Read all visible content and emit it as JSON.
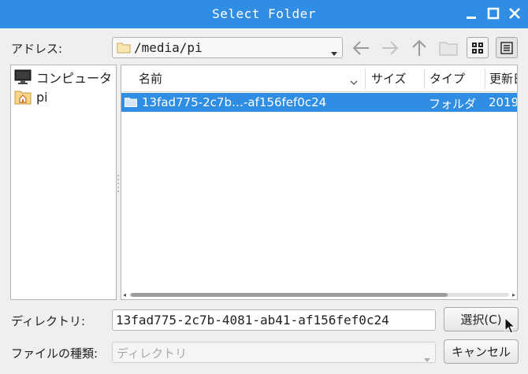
{
  "window": {
    "title": "Select Folder"
  },
  "address": {
    "label": "アドレス:",
    "path": "/media/pi"
  },
  "sidebar": {
    "items": [
      {
        "label": "コンピュータ",
        "icon": "computer-icon"
      },
      {
        "label": "pi",
        "icon": "home-folder-icon"
      }
    ]
  },
  "filelist": {
    "columns": [
      "名前",
      "サイズ",
      "タイプ",
      "更新日"
    ],
    "rows": [
      {
        "name": "13fad775-2c7b…-af156fef0c24",
        "type": "フォルダ",
        "modified": "2019"
      }
    ]
  },
  "directory": {
    "label": "ディレクトリ:",
    "value": "13fad775-2c7b-4081-ab41-af156fef0c24"
  },
  "filetype": {
    "label": "ファイルの種類:",
    "value": "ディレクトリ"
  },
  "buttons": {
    "select": "選択(C)",
    "cancel": "キャンセル"
  },
  "colors": {
    "titlebar": "#2f8de4",
    "selection": "#2f8de4"
  }
}
